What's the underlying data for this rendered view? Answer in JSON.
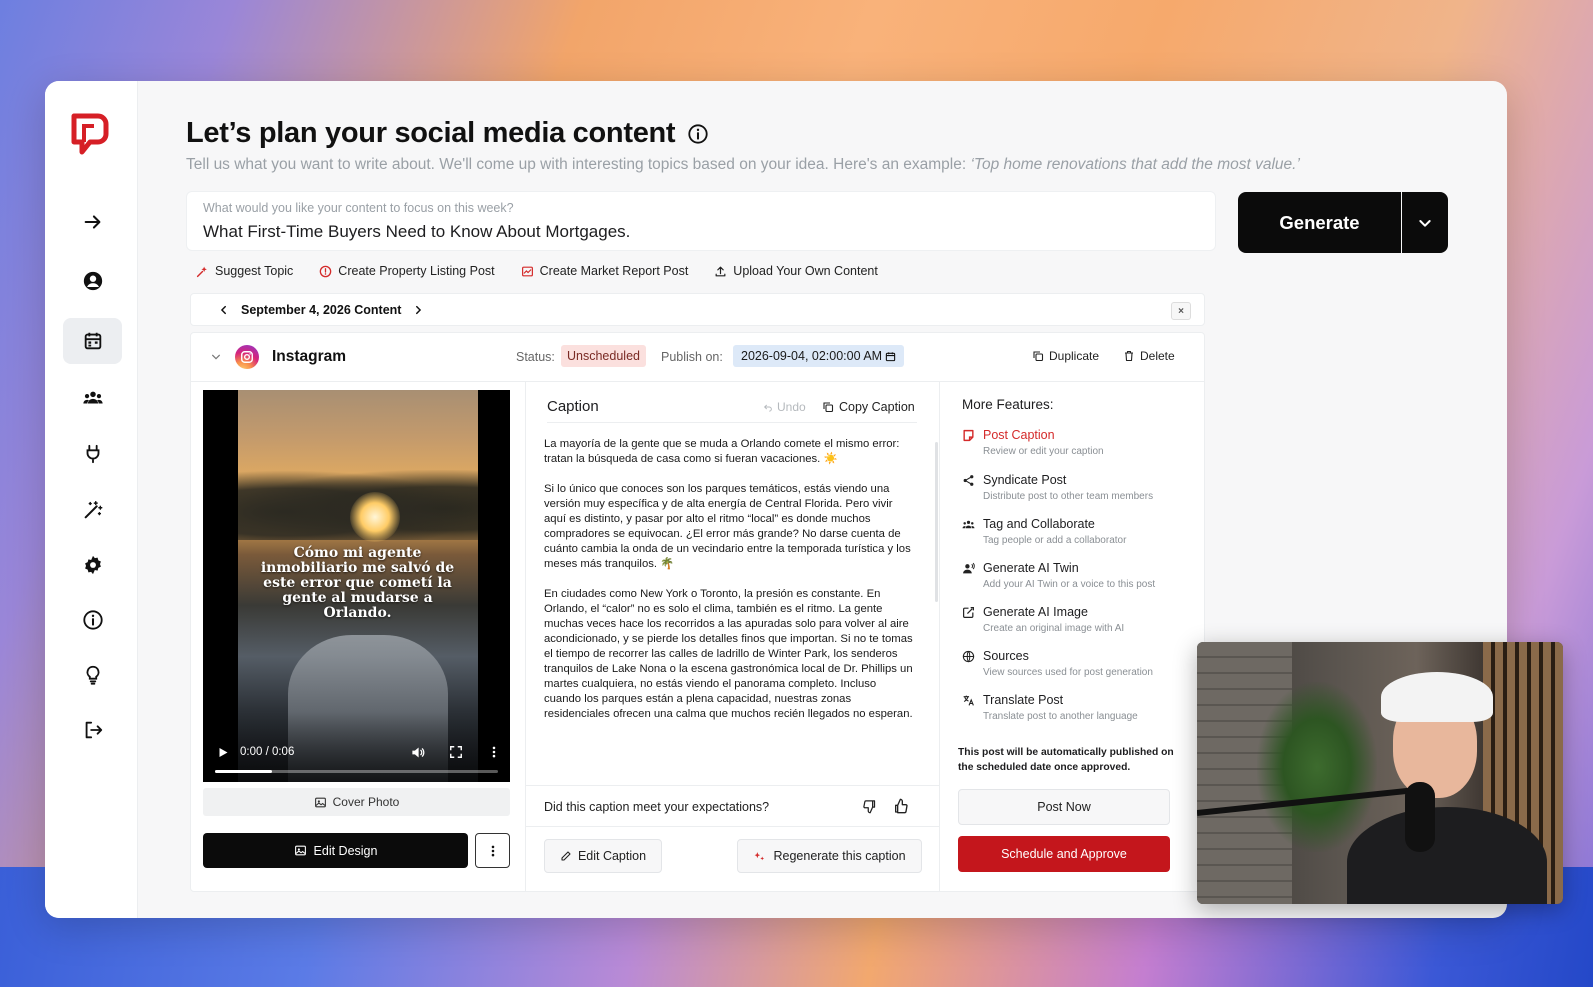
{
  "header": {
    "title": "Let’s plan your social media content",
    "subtitle": "Tell us what you want to write about. We'll come up with interesting topics based on your idea. Here's an example: ",
    "subtitle_example": "‘Top home renovations that add the most value.’"
  },
  "prompt": {
    "label": "What would you like your content to focus on this week?",
    "value": "What First-Time Buyers Need to Know About Mortgages."
  },
  "generate": {
    "label": "Generate"
  },
  "quick_actions": [
    {
      "label": "Suggest Topic",
      "icon": "sparkle-pin-icon"
    },
    {
      "label": "Create Property Listing Post",
      "icon": "alert-circle-icon"
    },
    {
      "label": "Create Market Report Post",
      "icon": "chart-report-icon"
    },
    {
      "label": "Upload Your Own Content",
      "icon": "upload-icon"
    }
  ],
  "date_bar": {
    "label": "September 4, 2026 Content",
    "close": "×"
  },
  "post": {
    "platform": "Instagram",
    "status_label": "Status:",
    "status": "Unscheduled",
    "publish_label": "Publish on:",
    "publish_value": "2026-09-04, 02:00:00 AM",
    "duplicate": "Duplicate",
    "delete": "Delete"
  },
  "media": {
    "overlay_text": "Cómo mi agente inmobiliario me salvó de este error que cometí la gente al mudarse a Orlando.",
    "time": "0:00 / 0:06",
    "progress": 0.2,
    "cover_photo": "Cover Photo",
    "edit_design": "Edit Design"
  },
  "caption": {
    "title": "Caption",
    "undo": "Undo",
    "copy": "Copy Caption",
    "paragraphs": [
      "La mayoría de la gente que se muda a Orlando comete el mismo error: tratan la búsqueda de casa como si fueran vacaciones. ☀️",
      "Si lo único que conoces son los parques temáticos, estás viendo una versión muy específica y de alta energía de Central Florida. Pero vivir aquí es distinto, y pasar por alto el ritmo “local” es donde muchos compradores se equivocan. ¿El error más grande? No darse cuenta de cuánto cambia la onda de un vecindario entre la temporada turística y los meses más tranquilos. 🌴",
      "En ciudades como New York o Toronto, la presión es constante. En Orlando, el “calor” no es solo el clima, también es el ritmo. La gente muchas veces hace los recorridos a las apuradas solo para volver al aire acondicionado, y se pierde los detalles finos que importan. Si no te tomas el tiempo de recorrer las calles de ladrillo de Winter Park, los senderos tranquilos de Lake Nona o la escena gastronómica local de Dr. Phillips un martes cualquiera, no estás viendo el panorama completo. Incluso cuando los parques están a plena capacidad, nuestras zonas residenciales ofrecen una calma que muchos recién llegados no esperan."
    ],
    "feedback_question": "Did this caption meet your expectations?",
    "edit": "Edit Caption",
    "regenerate": "Regenerate this caption"
  },
  "features": {
    "title": "More Features:",
    "items": [
      {
        "label": "Post Caption",
        "sub": "Review or edit your caption",
        "icon": "caption-icon"
      },
      {
        "label": "Syndicate Post",
        "sub": "Distribute post to other team members",
        "icon": "share-icon"
      },
      {
        "label": "Tag and Collaborate",
        "sub": "Tag people or add a collaborator",
        "icon": "people-icon"
      },
      {
        "label": "Generate AI Twin",
        "sub": "Add your AI Twin or a voice to this post",
        "icon": "ai-twin-icon"
      },
      {
        "label": "Generate AI Image",
        "sub": "Create an original image with AI",
        "icon": "image-edit-icon"
      },
      {
        "label": "Sources",
        "sub": "View sources used for post generation",
        "icon": "globe-icon"
      },
      {
        "label": "Translate Post",
        "sub": "Translate post to another language",
        "icon": "translate-icon"
      }
    ],
    "auto_note": "This post will be automatically published on the scheduled date once approved.",
    "post_now": "Post Now",
    "schedule": "Schedule and Approve"
  },
  "colors": {
    "accent_red": "#c4161c",
    "status_bg": "#fbe0de",
    "publish_bg": "#dde9f8"
  }
}
